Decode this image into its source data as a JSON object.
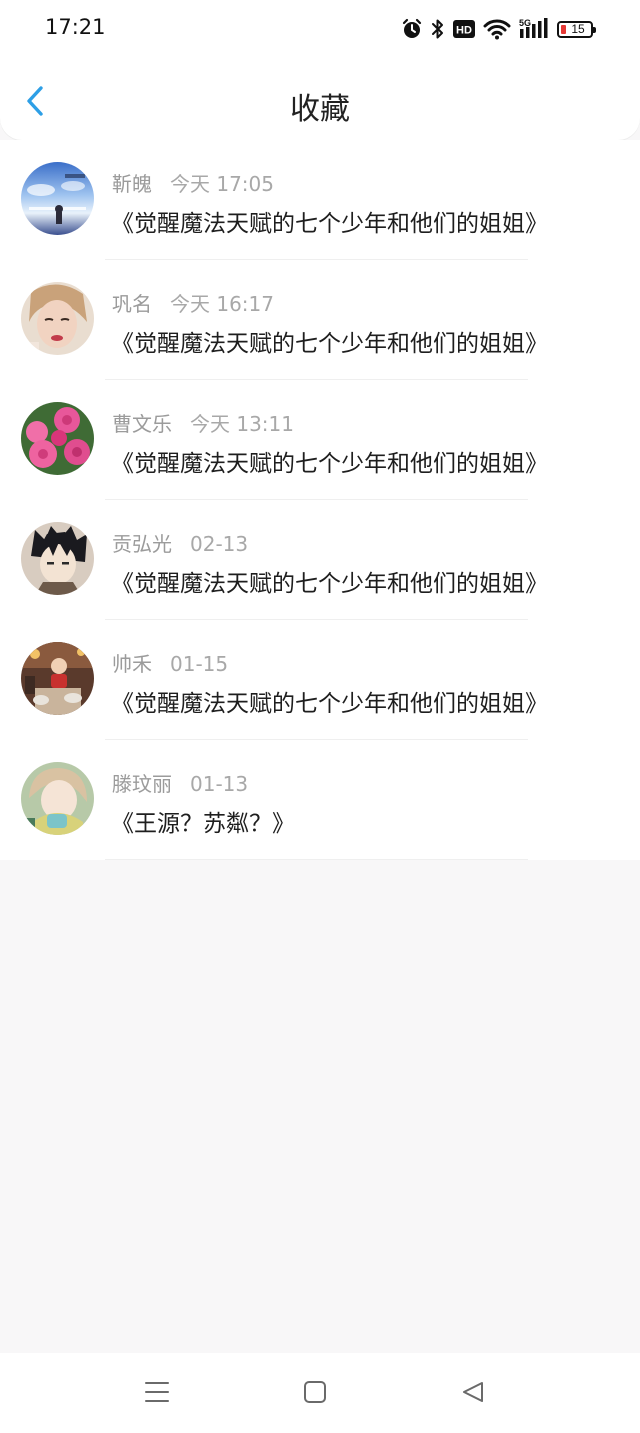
{
  "status_bar": {
    "time": "17:21",
    "battery": "15",
    "icons": [
      "alarm-icon",
      "bluetooth-icon",
      "hd-icon",
      "wifi-icon",
      "5g-signal-icon",
      "battery-icon"
    ]
  },
  "header": {
    "title": "收藏",
    "back_icon": "chevron-left-icon",
    "accent_color": "#2d9fe6"
  },
  "favorites": [
    {
      "user": "靳魄",
      "date": "今天 17:05",
      "book": "《觉醒魔法天赋的七个少年和他们的姐姐》"
    },
    {
      "user": "巩名",
      "date": "今天 16:17",
      "book": "《觉醒魔法天赋的七个少年和他们的姐姐》"
    },
    {
      "user": "曹文乐",
      "date": "今天 13:11",
      "book": "《觉醒魔法天赋的七个少年和他们的姐姐》"
    },
    {
      "user": "贡弘光",
      "date": "02-13",
      "book": "《觉醒魔法天赋的七个少年和他们的姐姐》"
    },
    {
      "user": "帅禾",
      "date": "01-15",
      "book": "《觉醒魔法天赋的七个少年和他们的姐姐》"
    },
    {
      "user": "滕玟丽",
      "date": "01-13",
      "book": "《王源？苏粼？》"
    }
  ],
  "nav_bar": {
    "icons": [
      "menu-icon",
      "home-icon",
      "back-triangle-icon"
    ]
  }
}
